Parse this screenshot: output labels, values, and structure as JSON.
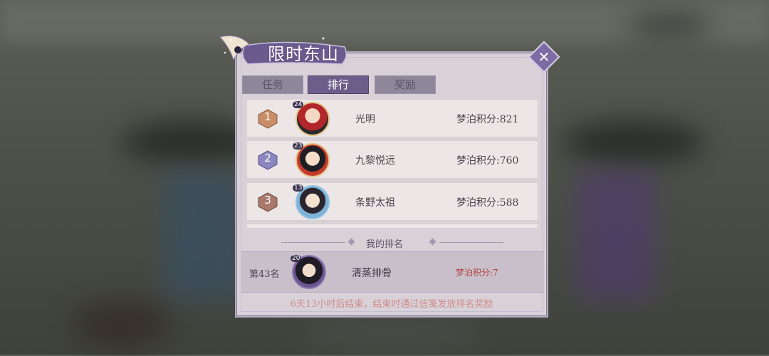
{
  "event": {
    "title": "限时东山",
    "close_icon": "close-x-icon"
  },
  "tabs": [
    {
      "label": "任务",
      "active": false
    },
    {
      "label": "排行",
      "active": true
    },
    {
      "label": "奖励",
      "active": false
    }
  ],
  "leaderboard": [
    {
      "rank": "1",
      "level": "24",
      "name": "光明",
      "score_label": "梦泊积分:821",
      "badge_color": "#c88d67"
    },
    {
      "rank": "2",
      "level": "23",
      "name": "九黎悦远",
      "score_label": "梦泊积分:760",
      "badge_color": "#8b86bd"
    },
    {
      "rank": "3",
      "level": "13",
      "name": "条野太祖",
      "score_label": "梦泊积分:588",
      "badge_color": "#a9796c"
    }
  ],
  "my_rank": {
    "section_title": "我的排名",
    "rank_label": "第43名",
    "level": "20",
    "name": "清蒸排骨",
    "score_label": "梦泊积分:7"
  },
  "footer": {
    "note": "6天13小时后结束，结束时通过信笺发放排名奖励"
  },
  "colors": {
    "panel": "#d8d2d8",
    "tab_active": "#6c5e8a",
    "score_highlight": "#b34141",
    "footer_text": "#cf8a8a"
  }
}
